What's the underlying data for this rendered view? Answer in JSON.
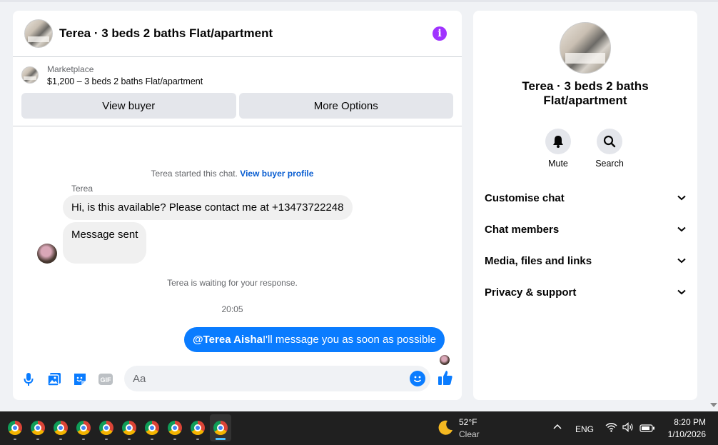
{
  "chat": {
    "header_title": "Terea · 3 beds 2 baths Flat/apartment",
    "marketplace_label": "Marketplace",
    "listing_price_title": "$1,200 – 3 beds 2 baths Flat/apartment",
    "view_buyer_label": "View buyer",
    "more_options_label": "More Options",
    "started_text": "Terea started this chat.",
    "view_buyer_profile_link": "View buyer profile",
    "sender_name": "Terea",
    "messages_in": [
      "Hi, is this available? Please contact me at +13473722248",
      "Message sent"
    ],
    "waiting_text": "Terea is waiting for your response.",
    "timestamp": "20:05",
    "message_out_mention": "@Terea Aisha",
    "message_out_text": "I'll message you as soon as possible",
    "input_placeholder": "Aa",
    "accent_color": "#0a7cff"
  },
  "details": {
    "title": "Terea · 3 beds 2 baths Flat/apartment",
    "actions": [
      {
        "label": "Mute",
        "icon": "bell-icon"
      },
      {
        "label": "Search",
        "icon": "search-icon"
      }
    ],
    "sections": [
      "Customise chat",
      "Chat members",
      "Media, files and links",
      "Privacy & support"
    ]
  },
  "taskbar": {
    "app_count": 10,
    "weather_temp": "52°F",
    "weather_desc": "Clear",
    "language": "ENG",
    "time": "8:20 PM",
    "date": "1/10/2026"
  }
}
